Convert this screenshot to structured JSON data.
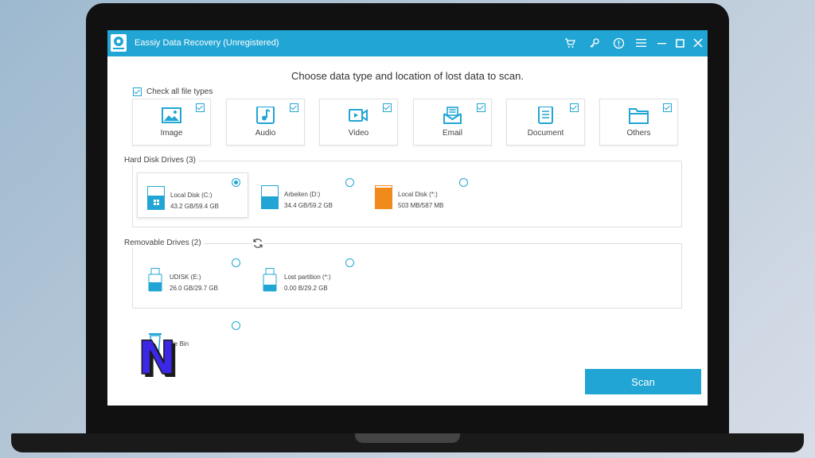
{
  "app": {
    "title": "Eassiy Data Recovery (Unregistered)",
    "accent_color": "#21a5d4",
    "titlebar_icons": [
      "cart-icon",
      "key-icon",
      "feedback-icon",
      "menu-icon",
      "minimize-icon",
      "maximize-icon",
      "close-icon"
    ]
  },
  "main": {
    "heading": "Choose data type and location of lost data to scan.",
    "check_all_label": "Check all file types",
    "check_all_checked": true
  },
  "file_types": [
    {
      "label": "Image",
      "icon": "image-icon",
      "checked": true
    },
    {
      "label": "Audio",
      "icon": "audio-icon",
      "checked": true
    },
    {
      "label": "Video",
      "icon": "video-icon",
      "checked": true
    },
    {
      "label": "Email",
      "icon": "email-icon",
      "checked": true
    },
    {
      "label": "Document",
      "icon": "document-icon",
      "checked": true
    },
    {
      "label": "Others",
      "icon": "folder-icon",
      "checked": true
    }
  ],
  "hard_disk": {
    "title": "Hard Disk Drives (3)",
    "drives": [
      {
        "name": "Local Disk (C:)",
        "size": "43.2 GB/59.4 GB",
        "icon": "windows-drive-icon",
        "color": "#21a5d4",
        "selected": true
      },
      {
        "name": "Arbeiten (D:)",
        "size": "34.4 GB/59.2 GB",
        "icon": "drive-icon",
        "color": "#21a5d4",
        "selected": false
      },
      {
        "name": "Local Disk (*:)",
        "size": "503 MB/587 MB",
        "icon": "drive-icon",
        "color": "#f08a1c",
        "selected": false
      }
    ]
  },
  "removable": {
    "title": "Removable Drives (2)",
    "refresh_icon": "refresh-icon",
    "drives": [
      {
        "name": "UDISK (E:)",
        "size": "26.0 GB/29.7 GB",
        "icon": "usb-drive-icon",
        "selected": false
      },
      {
        "name": "Lost partition (*:)",
        "size": "0.00  B/29.2 GB",
        "icon": "usb-drive-icon",
        "selected": false
      }
    ]
  },
  "recycle": {
    "label": "cle Bin",
    "icon": "recycle-bin-icon",
    "selected": false
  },
  "actions": {
    "scan_label": "Scan"
  },
  "watermark": {
    "letter": "N"
  }
}
